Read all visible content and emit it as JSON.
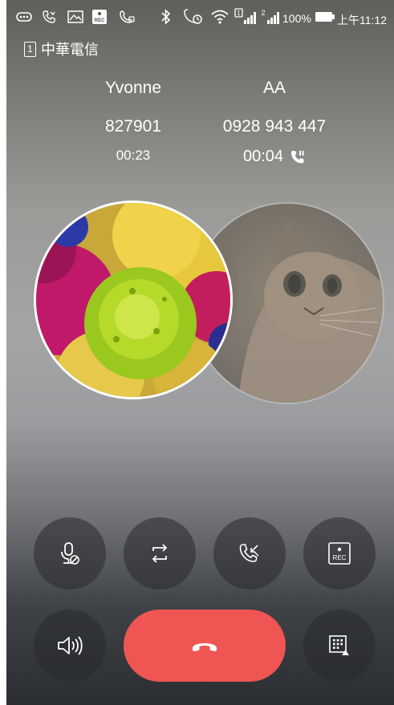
{
  "status_bar": {
    "battery": "100%",
    "time": "上午11:12",
    "sim1": "1",
    "sim2": "2",
    "rec_label": "REC"
  },
  "carrier": {
    "sim_slot": "1",
    "name": "中華電信"
  },
  "calls": [
    {
      "name": "Yvonne",
      "number": "827901",
      "duration": "00:23"
    },
    {
      "name": "AA",
      "number": "0928 943 447",
      "duration": "00:04"
    }
  ],
  "controls": {
    "row1": [
      "mute-mic",
      "swap-calls",
      "merge-calls",
      "record"
    ],
    "row2": [
      "speaker",
      "end-call",
      "dialpad"
    ],
    "record_label": "REC"
  },
  "colors": {
    "end_call": "#ee5553",
    "button_bg": "#2a2c30"
  }
}
